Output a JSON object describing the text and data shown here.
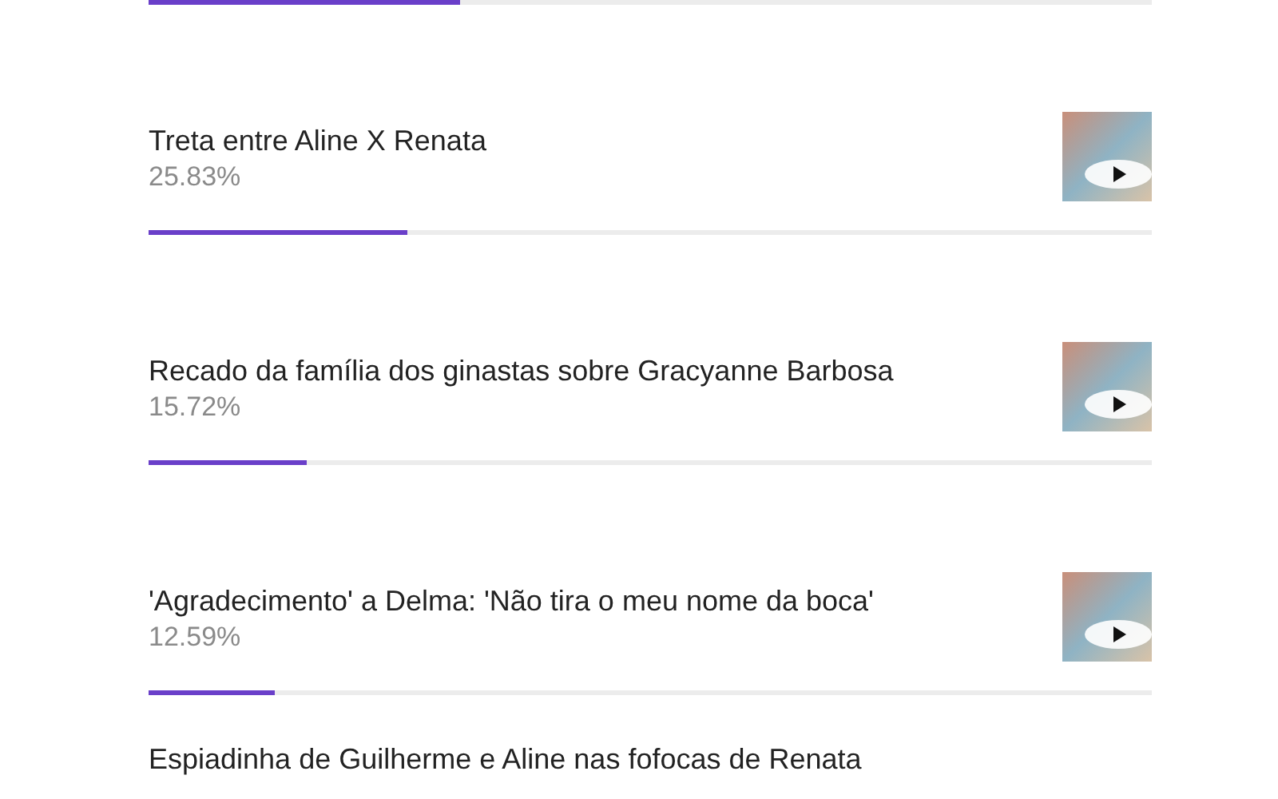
{
  "top_item": {
    "level": 0.31
  },
  "items": [
    {
      "title": "Treta entre Aline X Renata",
      "percentage": "25.83%",
      "level": 0.2583
    },
    {
      "title": "Recado da família dos ginastas sobre Gracyanne Barbosa",
      "percentage": "15.72%",
      "level": 0.1572
    },
    {
      "title": "'Agradecimento' a Delma: 'Não tira o meu nome da boca'",
      "percentage": "12.59%",
      "level": 0.1259
    },
    {
      "title": "Espiadinha de Guilherme e Aline nas fofocas de Renata"
    }
  ]
}
